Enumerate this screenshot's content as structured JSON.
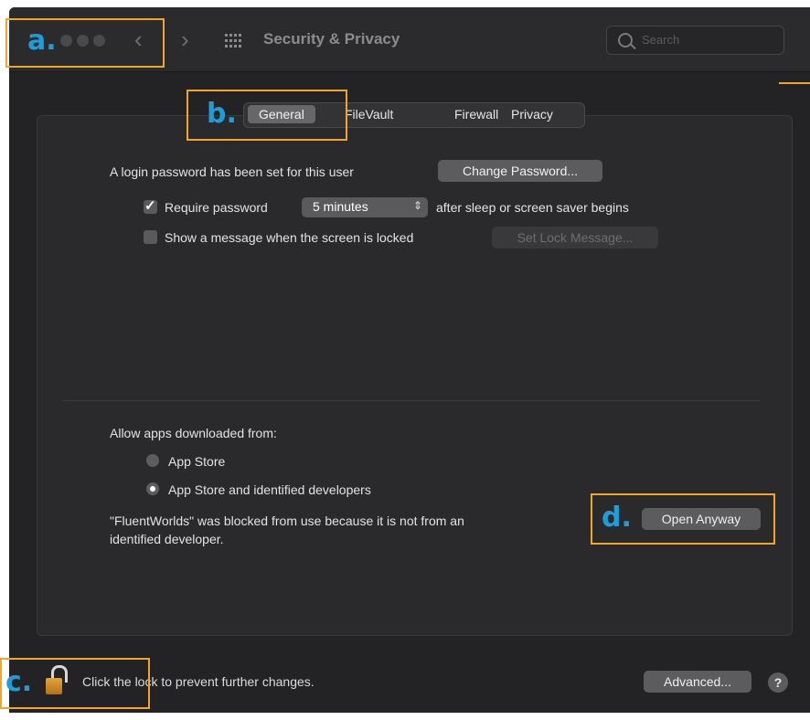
{
  "window": {
    "title": "Security & Privacy"
  },
  "toolbar": {
    "back_icon": "chevron-left",
    "forward_icon": "chevron-right",
    "grid_icon": "show-all-grid",
    "search_placeholder": "Search"
  },
  "tabs": [
    {
      "label": "General",
      "active": true
    },
    {
      "label": "FileVault",
      "active": false
    },
    {
      "label": "Firewall",
      "active": false
    },
    {
      "label": "Privacy",
      "active": false
    }
  ],
  "general": {
    "login_password_text": "A login password has been set for this user",
    "change_password_label": "Change Password...",
    "require_password": {
      "checked": true,
      "label": "Require password",
      "delay_value": "5 minutes",
      "suffix": "after sleep or screen saver begins"
    },
    "show_message": {
      "checked": false,
      "label": "Show a message when the screen is locked",
      "button_label": "Set Lock Message..."
    }
  },
  "downloads": {
    "heading": "Allow apps downloaded from:",
    "options": [
      {
        "label": "App Store",
        "selected": false
      },
      {
        "label": "App Store and identified developers",
        "selected": true
      }
    ],
    "blocked_line1": "\"FluentWorlds\" was blocked from use because it is not from an",
    "blocked_line2": "identified developer.",
    "open_anyway_label": "Open Anyway"
  },
  "footer": {
    "lock_text": "Click the lock to prevent further changes.",
    "advanced_label": "Advanced...",
    "help_label": "?"
  },
  "annotations": {
    "a": "a.",
    "b": "b.",
    "c": "c.",
    "d": "d.",
    "color": "#f2a52b",
    "marker_color": "#1e9ed8"
  }
}
